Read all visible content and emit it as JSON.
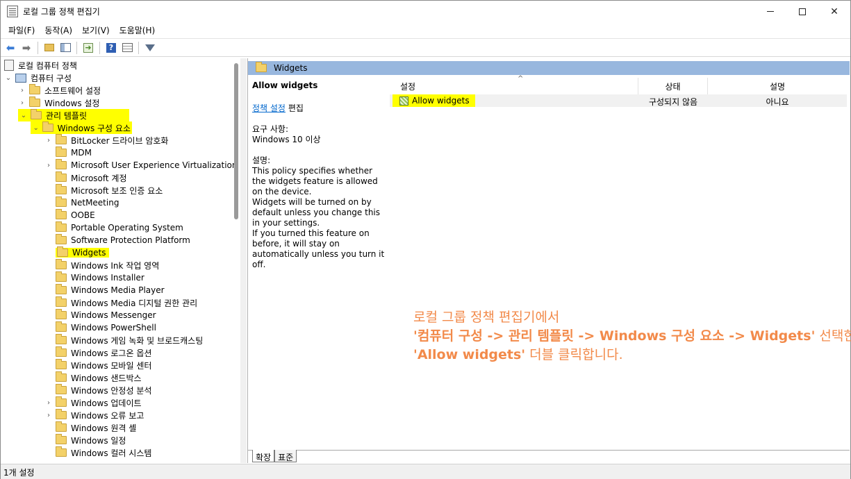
{
  "window": {
    "title": "로컬 그룹 정책 편집기"
  },
  "menu": [
    "파일(F)",
    "동작(A)",
    "보기(V)",
    "도움말(H)"
  ],
  "tree": {
    "root": "로컬 컴퓨터 정책",
    "computer": "컴퓨터 구성",
    "software": "소프트웨어 설정",
    "windows_settings": "Windows 설정",
    "admin_templates": "관리 템플릿",
    "windows_components": "Windows 구성 요소",
    "items": [
      "BitLocker 드라이브 암호화",
      "MDM",
      "Microsoft User Experience Virtualization",
      "Microsoft 계정",
      "Microsoft 보조 인증 요소",
      "NetMeeting",
      "OOBE",
      "Portable Operating System",
      "Software Protection Platform",
      "Widgets",
      "Windows Ink 작업 영역",
      "Windows Installer",
      "Windows Media Player",
      "Windows Media 디지털 권한 관리",
      "Windows Messenger",
      "Windows PowerShell",
      "Windows 게임 녹화 및 브로드캐스팅",
      "Windows 로그온 옵션",
      "Windows 모바일 센터",
      "Windows 샌드박스",
      "Windows 안정성 분석",
      "Windows 업데이트",
      "Windows 오류 보고",
      "Windows 원격 셸",
      "Windows 일정",
      "Windows 컬러 시스템"
    ]
  },
  "right": {
    "header": "Widgets",
    "extended": {
      "title": "Allow widgets",
      "edit_link": "정책 설정",
      "edit_suffix": "편집",
      "requirements_label": "요구 사항:",
      "requirements_value": "Windows 10 이상",
      "description_label": "설명:",
      "description": "This policy specifies whether the widgets feature is allowed on the device.\nWidgets will be turned on by default unless you change this in your settings.\nIf you turned this feature on before, it will stay on automatically unless you turn it off."
    },
    "columns": {
      "setting": "설정",
      "state": "상태",
      "comment": "설명"
    },
    "row": {
      "name": "Allow widgets",
      "state": "구성되지 않음",
      "comment": "아니요"
    },
    "tabs": [
      "확장",
      "표준"
    ]
  },
  "annotation": {
    "line1": "로컬 그룹 정책 편집기에서",
    "line2_a": "'컴퓨터 구성 -> 관리 템플릿 -> Windows 구성 요소 -> Widgets'",
    "line2_b": " 선택한 다음",
    "line3_a": "'Allow widgets'",
    "line3_b": " 더블 클릭합니다."
  },
  "status": "1개 설정"
}
